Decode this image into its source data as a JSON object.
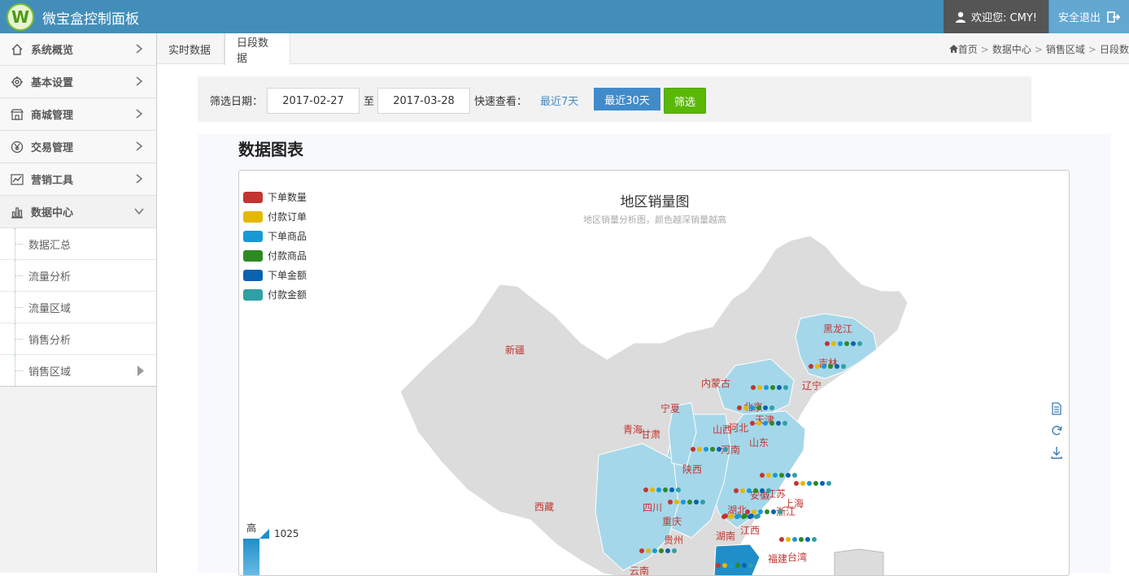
{
  "app": {
    "logo_letter": "W",
    "title": "微宝盒控制面板"
  },
  "user": {
    "welcome": "欢迎您: CMY!",
    "logout": "安全退出"
  },
  "sidebar": {
    "items": [
      {
        "label": "系统概览",
        "icon": "home-icon"
      },
      {
        "label": "基本设置",
        "icon": "gear-icon"
      },
      {
        "label": "商城管理",
        "icon": "shop-icon"
      },
      {
        "label": "交易管理",
        "icon": "yen-icon"
      },
      {
        "label": "营销工具",
        "icon": "trend-icon"
      },
      {
        "label": "数据中心",
        "icon": "bar-chart-icon",
        "expanded": true
      }
    ],
    "sub_items": [
      {
        "label": "数据汇总"
      },
      {
        "label": "流量分析"
      },
      {
        "label": "流量区域"
      },
      {
        "label": "销售分析"
      },
      {
        "label": "销售区域",
        "active": true
      }
    ]
  },
  "tabs": [
    {
      "label": "实时数据"
    },
    {
      "label": "日段数据",
      "active": true
    }
  ],
  "breadcrumb": {
    "home": "首页",
    "c1": "数据中心",
    "c2": "销售区域",
    "c3": "日段数"
  },
  "filter": {
    "label": "筛选日期：",
    "start": "2017-02-27",
    "to": "至",
    "end": "2017-03-28",
    "quick_label": "快速查看：",
    "last7": "最近7天",
    "last30": "最近30天",
    "submit": "筛选"
  },
  "section_title": "数据图表",
  "chart_data": {
    "type": "map",
    "title": "地区销量图",
    "subtitle": "地区销量分析图，颜色越深销量越高",
    "legend": [
      {
        "name": "下单数量",
        "color": "#c23531"
      },
      {
        "name": "付款订单",
        "color": "#e5b800"
      },
      {
        "name": "下单商品",
        "color": "#1899d6"
      },
      {
        "name": "付款商品",
        "color": "#2d8a22"
      },
      {
        "name": "下单金额",
        "color": "#0a62b0"
      },
      {
        "name": "付款金额",
        "color": "#2fa0a6"
      }
    ],
    "visual_map": {
      "high_label": "高",
      "max": 1025
    },
    "gray_color": "#dcdcdc",
    "light_color": "#a5d7ea",
    "dark_color": "#1f8ec9",
    "regions": [
      {
        "name": "新疆"
      },
      {
        "name": "西藏"
      },
      {
        "name": "青海"
      },
      {
        "name": "甘肃"
      },
      {
        "name": "宁夏"
      },
      {
        "name": "内蒙古"
      },
      {
        "name": "黑龙江"
      },
      {
        "name": "吉林"
      },
      {
        "name": "辽宁"
      },
      {
        "name": "北京"
      },
      {
        "name": "天津"
      },
      {
        "name": "河北"
      },
      {
        "name": "山西"
      },
      {
        "name": "山东"
      },
      {
        "name": "河南"
      },
      {
        "name": "陕西"
      },
      {
        "name": "四川"
      },
      {
        "name": "重庆"
      },
      {
        "name": "湖北"
      },
      {
        "name": "安徽"
      },
      {
        "name": "江苏"
      },
      {
        "name": "上海"
      },
      {
        "name": "浙江"
      },
      {
        "name": "湖南"
      },
      {
        "name": "江西"
      },
      {
        "name": "贵州"
      },
      {
        "name": "福建"
      },
      {
        "name": "台湾"
      },
      {
        "name": "云南"
      }
    ]
  },
  "toolbox": [
    "data-view-icon",
    "refresh-icon",
    "download-icon"
  ]
}
